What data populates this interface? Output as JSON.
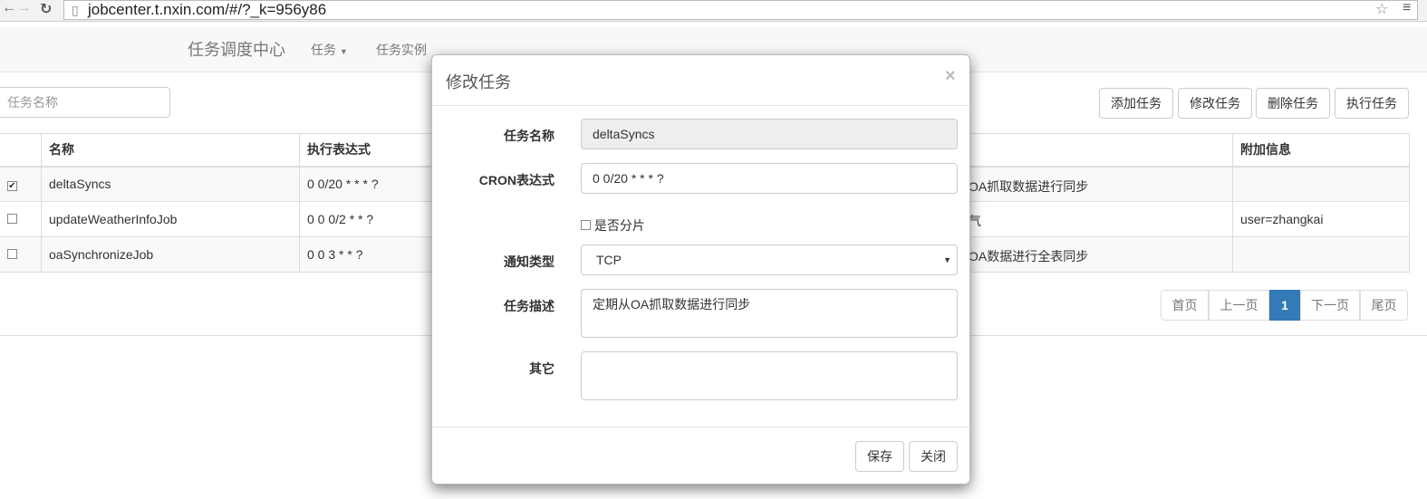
{
  "browser": {
    "url": "jobcenter.t.nxin.com/#/?_k=956y86"
  },
  "navbar": {
    "brand": "任务调度中心",
    "menu_tasks": "任务",
    "menu_instances": "任务实例"
  },
  "search": {
    "placeholder": "任务名称"
  },
  "toolbar": {
    "add": "添加任务",
    "edit": "修改任务",
    "delete": "删除任务",
    "run": "执行任务"
  },
  "table": {
    "headers": {
      "name": "名称",
      "cron": "执行表达式",
      "extra": "附加信息"
    },
    "rows": [
      {
        "checked": true,
        "name": "deltaSyncs",
        "cron": "0 0/20 * * * ?",
        "desc_visible": "OA抓取数据进行同步",
        "extra": ""
      },
      {
        "checked": false,
        "name": "updateWeatherInfoJob",
        "cron": "0 0 0/2 * * ?",
        "desc_visible": "气",
        "extra": "user=zhangkai"
      },
      {
        "checked": false,
        "name": "oaSynchronizeJob",
        "cron": "0 0 3 * * ?",
        "desc_visible": "OA数据进行全表同步",
        "extra": ""
      }
    ]
  },
  "pagination": {
    "first": "首页",
    "prev": "上一页",
    "current": "1",
    "next": "下一页",
    "last": "尾页",
    "active_color": "#337ab7"
  },
  "modal": {
    "title": "修改任务",
    "close": "×",
    "name_label": "任务名称",
    "name_value": "deltaSyncs",
    "cron_label": "CRON表达式",
    "cron_value": "0 0/20 * * * ?",
    "shard_label": "是否分片",
    "notify_label": "通知类型",
    "notify_value": "TCP",
    "desc_label": "任务描述",
    "desc_value": "定期从OA抓取数据进行同步",
    "other_label": "其它",
    "other_value": "",
    "save": "保存",
    "close_btn": "关闭"
  }
}
